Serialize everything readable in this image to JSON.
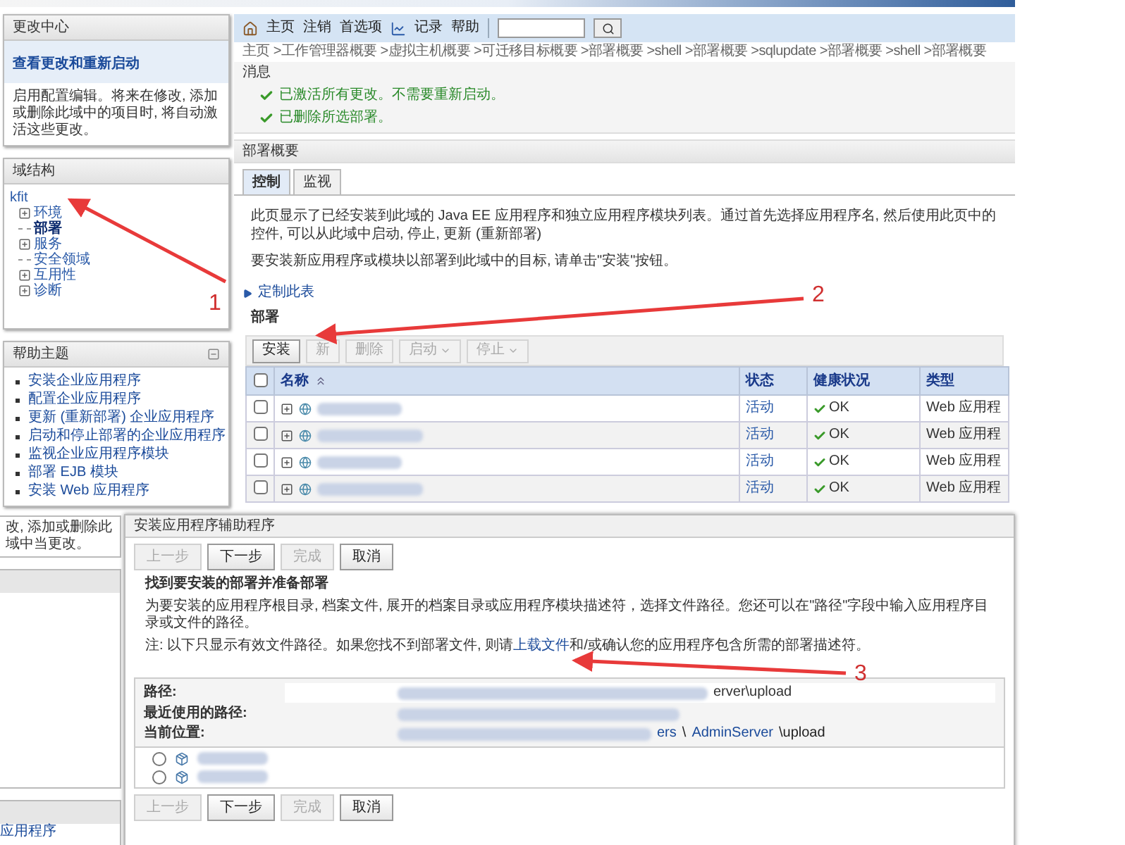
{
  "change_center": {
    "title": "更改中心",
    "link": "查看更改和重新启动",
    "text": "启用配置编辑。将来在修改, 添加或删除此域中的项目时, 将自动激活这些更改。"
  },
  "domain_structure": {
    "title": "域结构",
    "tree": [
      {
        "label": "kfit",
        "selected": false,
        "children": [
          {
            "label": "环境",
            "kind": "folder",
            "selected": false
          },
          {
            "label": "部署",
            "kind": "leaf",
            "selected": true
          },
          {
            "label": "服务",
            "kind": "folder",
            "selected": false
          },
          {
            "label": "安全领域",
            "kind": "leaf",
            "selected": false
          },
          {
            "label": "互用性",
            "kind": "folder",
            "selected": false
          },
          {
            "label": "诊断",
            "kind": "folder",
            "selected": false
          }
        ]
      }
    ]
  },
  "help_topics": {
    "title": "帮助主题",
    "items": [
      "安装企业应用程序",
      "配置企业应用程序",
      "更新 (重新部署) 企业应用程序",
      "启动和停止部署的企业应用程序",
      "监视企业应用程序模块",
      "部署 EJB 模块",
      "安装 Web 应用程序"
    ]
  },
  "toolbar": {
    "links": [
      {
        "label": "主页",
        "kind": "home"
      },
      {
        "label": "注销",
        "kind": "plain"
      },
      {
        "label": "首选项",
        "kind": "plain"
      },
      {
        "label": "记录",
        "kind": "record"
      },
      {
        "label": "帮助",
        "kind": "plain"
      }
    ]
  },
  "breadcrumb": "主页 >工作管理器概要 >虚拟主机概要 >可迁移目标概要 >部署概要 >shell >部署概要 >sqlupdate >部署概要 >shell >部署概要",
  "messages": {
    "title": "消息",
    "items": [
      "已激活所有更改。不需要重新启动。",
      "已删除所选部署。"
    ]
  },
  "deployments_summary": {
    "title": "部署概要",
    "tabs": [
      {
        "label": "控制",
        "selected": true
      },
      {
        "label": "监视",
        "selected": false
      }
    ],
    "paragraphs": [
      "此页显示了已经安装到此域的 Java EE 应用程序和独立应用程序模块列表。通过首先选择应用程序名, 然后使用此页中的控件, 可以从此域中启动, 停止, 更新 (重新部署)",
      "要安装新应用程序或模块以部署到此域中的目标, 请单击\"安装\"按钮。"
    ],
    "customize_link": "定制此表",
    "table_title": "部署",
    "actions": [
      {
        "label": "安装",
        "disabled": false,
        "dropdown": false
      },
      {
        "label": "新",
        "disabled": true,
        "dropdown": false
      },
      {
        "label": "删除",
        "disabled": true,
        "dropdown": false
      },
      {
        "label": "启动",
        "disabled": true,
        "dropdown": true
      },
      {
        "label": "停止",
        "disabled": true,
        "dropdown": true
      }
    ],
    "table": {
      "header_checked": false,
      "columns": [
        "名称",
        "状态",
        "健康状况",
        "类型"
      ],
      "rows": [
        {
          "checked": false,
          "status": "活动",
          "health": "OK",
          "type": "Web 应用程"
        },
        {
          "checked": false,
          "status": "活动",
          "health": "OK",
          "type": "Web 应用程"
        },
        {
          "checked": false,
          "status": "活动",
          "health": "OK",
          "type": "Web 应用程"
        },
        {
          "checked": false,
          "status": "活动",
          "health": "OK",
          "type": "Web 应用程"
        }
      ]
    }
  },
  "background_fragment": {
    "text": "改, 添加或删除此域中当更改。",
    "bottom_link": "应用程序"
  },
  "install_wizard": {
    "title": "安装应用程序辅助程序",
    "buttons": [
      {
        "label": "上一步",
        "disabled": true
      },
      {
        "label": "下一步",
        "disabled": false
      },
      {
        "label": "完成",
        "disabled": true
      },
      {
        "label": "取消",
        "disabled": false
      }
    ],
    "heading": "找到要安装的部署并准备部署",
    "description": "为要安装的应用程序根目录, 档案文件, 展开的档案目录或应用程序模块描述符，选择文件路径。您还可以在\"路径\"字段中输入应用程序目录或文件的路径。",
    "note": {
      "before": "注: 以下只显示有效文件路径。如果您找不到部署文件, 则请",
      "link": "上载文件",
      "after": "和/或确认您的应用程序包含所需的部署描述符。"
    },
    "path_label": "路径:",
    "path_value": "erver\\upload",
    "recent_label": "最近使用的路径:",
    "current_label": "当前位置:",
    "current_path": [
      {
        "text": "ers",
        "link": true
      },
      {
        "text": "\\",
        "link": false
      },
      {
        "text": "AdminServer",
        "link": true
      },
      {
        "text": "\\upload",
        "link": false
      }
    ],
    "locations": [
      {
        "selected": false
      },
      {
        "selected": false
      }
    ],
    "bottom_buttons": [
      {
        "label": "上一步",
        "disabled": true
      },
      {
        "label": "下一步",
        "disabled": false
      },
      {
        "label": "完成",
        "disabled": true
      },
      {
        "label": "取消",
        "disabled": false
      }
    ]
  },
  "annotations": [
    {
      "label": "1"
    },
    {
      "label": "2"
    },
    {
      "label": "3"
    }
  ]
}
